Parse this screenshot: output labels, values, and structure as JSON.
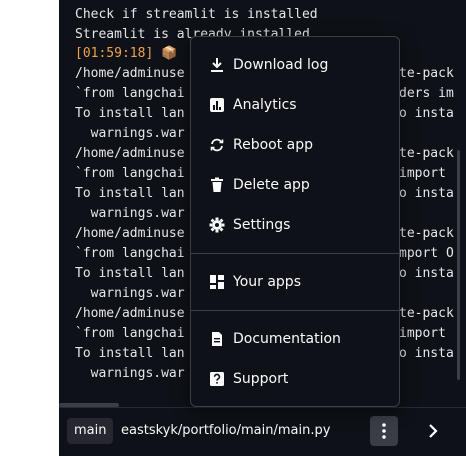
{
  "console": {
    "lines": [
      "Check if streamlit is installed",
      "Streamlit is already installed",
      "[01:59:18] 📦",
      "/home/adminuse",
      "`from langchai",
      "To install lan",
      "  warnings.war",
      "/home/adminuse",
      "`from langchai",
      "To install lan",
      "  warnings.war",
      "/home/adminuse",
      "`from langchai",
      "To install lan",
      "  warnings.war",
      "/home/adminuse",
      "`from langchai",
      "To install lan",
      "  warnings.war"
    ],
    "right_fragments": [
      "",
      "",
      "",
      "te-pack",
      "ders im",
      "o insta",
      "",
      "te-pack",
      "import",
      "o insta",
      "",
      "te-pack",
      "mport O",
      "o insta",
      "",
      "te-pack",
      "import",
      "o insta",
      ""
    ]
  },
  "footer": {
    "branch": "main",
    "path": "eastskyk/portfolio/main/main.py"
  },
  "menu": {
    "download": "Download log",
    "analytics": "Analytics",
    "reboot": "Reboot app",
    "delete": "Delete app",
    "settings": "Settings",
    "your_apps": "Your apps",
    "documentation": "Documentation",
    "support": "Support"
  },
  "colors": {
    "background": "#0e1117",
    "timestamp": "#f0a24b",
    "text": "#e6e7ea"
  }
}
